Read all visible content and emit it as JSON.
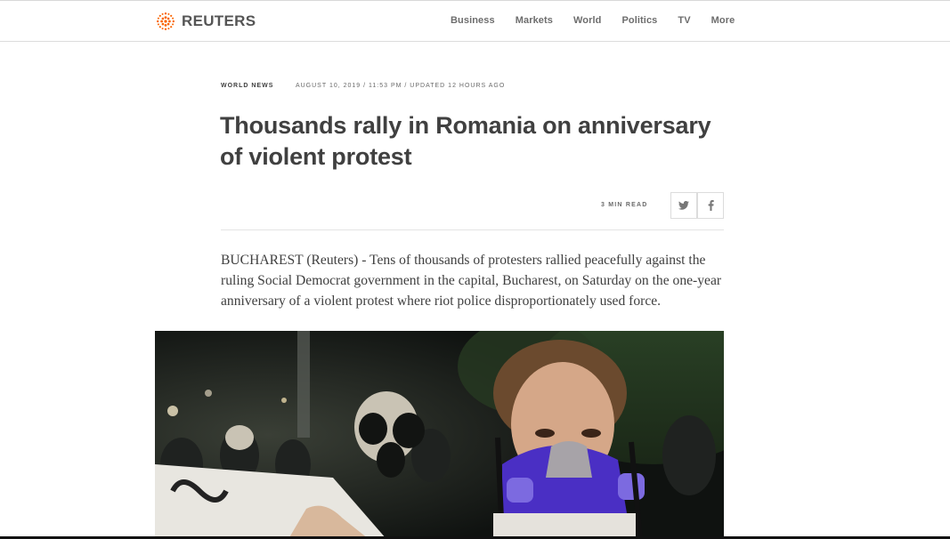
{
  "brand": {
    "name": "REUTERS",
    "accent": "#fa6400"
  },
  "nav": {
    "items": [
      {
        "label": "Business"
      },
      {
        "label": "Markets"
      },
      {
        "label": "World"
      },
      {
        "label": "Politics"
      },
      {
        "label": "TV"
      },
      {
        "label": "More"
      }
    ]
  },
  "article": {
    "section": "WORLD NEWS",
    "dateline": "AUGUST 10, 2019 / 11:53 PM / UPDATED 12 HOURS AGO",
    "headline": "Thousands rally in Romania on anniversary of violent protest",
    "read_time": "3 MIN READ",
    "lede": "BUCHAREST (Reuters) - Tens of thousands of protesters rallied peacefully against the ruling Social Democrat government in the capital, Bucharest, on Saturday on the one-year anniversary of a violent protest where riot police disproportionately used force."
  },
  "share": {
    "twitter_icon": "twitter-icon",
    "facebook_icon": "facebook-icon"
  },
  "photo": {
    "subject": "protesters-wearing-gas-masks",
    "mask_color": "#4a2fc4"
  }
}
